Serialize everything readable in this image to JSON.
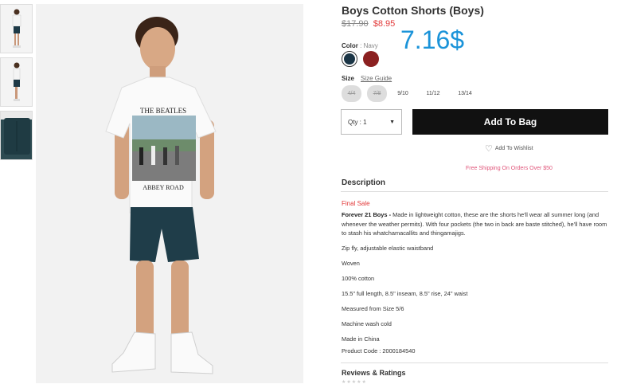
{
  "product": {
    "title": "Boys Cotton Shorts (Boys)",
    "old_price": "$17.90",
    "sale_price": "$8.95",
    "overlay_price": "7.16$"
  },
  "color": {
    "label": "Color",
    "separator": " : ",
    "value": "Navy",
    "swatches": [
      {
        "name": "Navy",
        "hex": "#1b3546",
        "selected": true
      },
      {
        "name": "Red",
        "hex": "#8b2020",
        "selected": false
      }
    ]
  },
  "size": {
    "label": "Size",
    "guide": "Size Guide",
    "options": [
      {
        "label": "4/4",
        "available": false
      },
      {
        "label": "7/8",
        "available": false
      },
      {
        "label": "9/10",
        "available": true
      },
      {
        "label": "11/12",
        "available": true
      },
      {
        "label": "13/14",
        "available": true
      }
    ]
  },
  "qty": {
    "label": "Qty : 1",
    "caret": "▼"
  },
  "add_to_bag": "Add To Bag",
  "wishlist": "Add To Wishlist",
  "shipping": "Free Shipping On Orders Over $50",
  "description": {
    "heading": "Description",
    "final_sale": "Final Sale",
    "brand_line": "Forever 21 Boys -",
    "body": "Made in lightweight cotton, these are the shorts he'll wear all summer long (and whenever the weather permits). With four pockets (the two in back are baste stitched), he'll have room to stash his whatchamacallits and thingamajigs.",
    "lines": [
      "Zip fly, adjustable elastic waistband",
      "Woven",
      "100% cotton",
      "15.5\" full length, 8.5\" inseam, 8.5\" rise, 24\" waist",
      "Measured from Size 5/6",
      "Machine wash cold",
      "Made in China",
      "Product Code : 2000184540"
    ]
  },
  "reviews": {
    "heading": "Reviews & Ratings",
    "stars": "★★★★★"
  },
  "colors": {
    "accent_blue": "#1a93d9",
    "sale_red": "#e23a3a",
    "shipping_pink": "#e0557a",
    "button": "#111111"
  }
}
